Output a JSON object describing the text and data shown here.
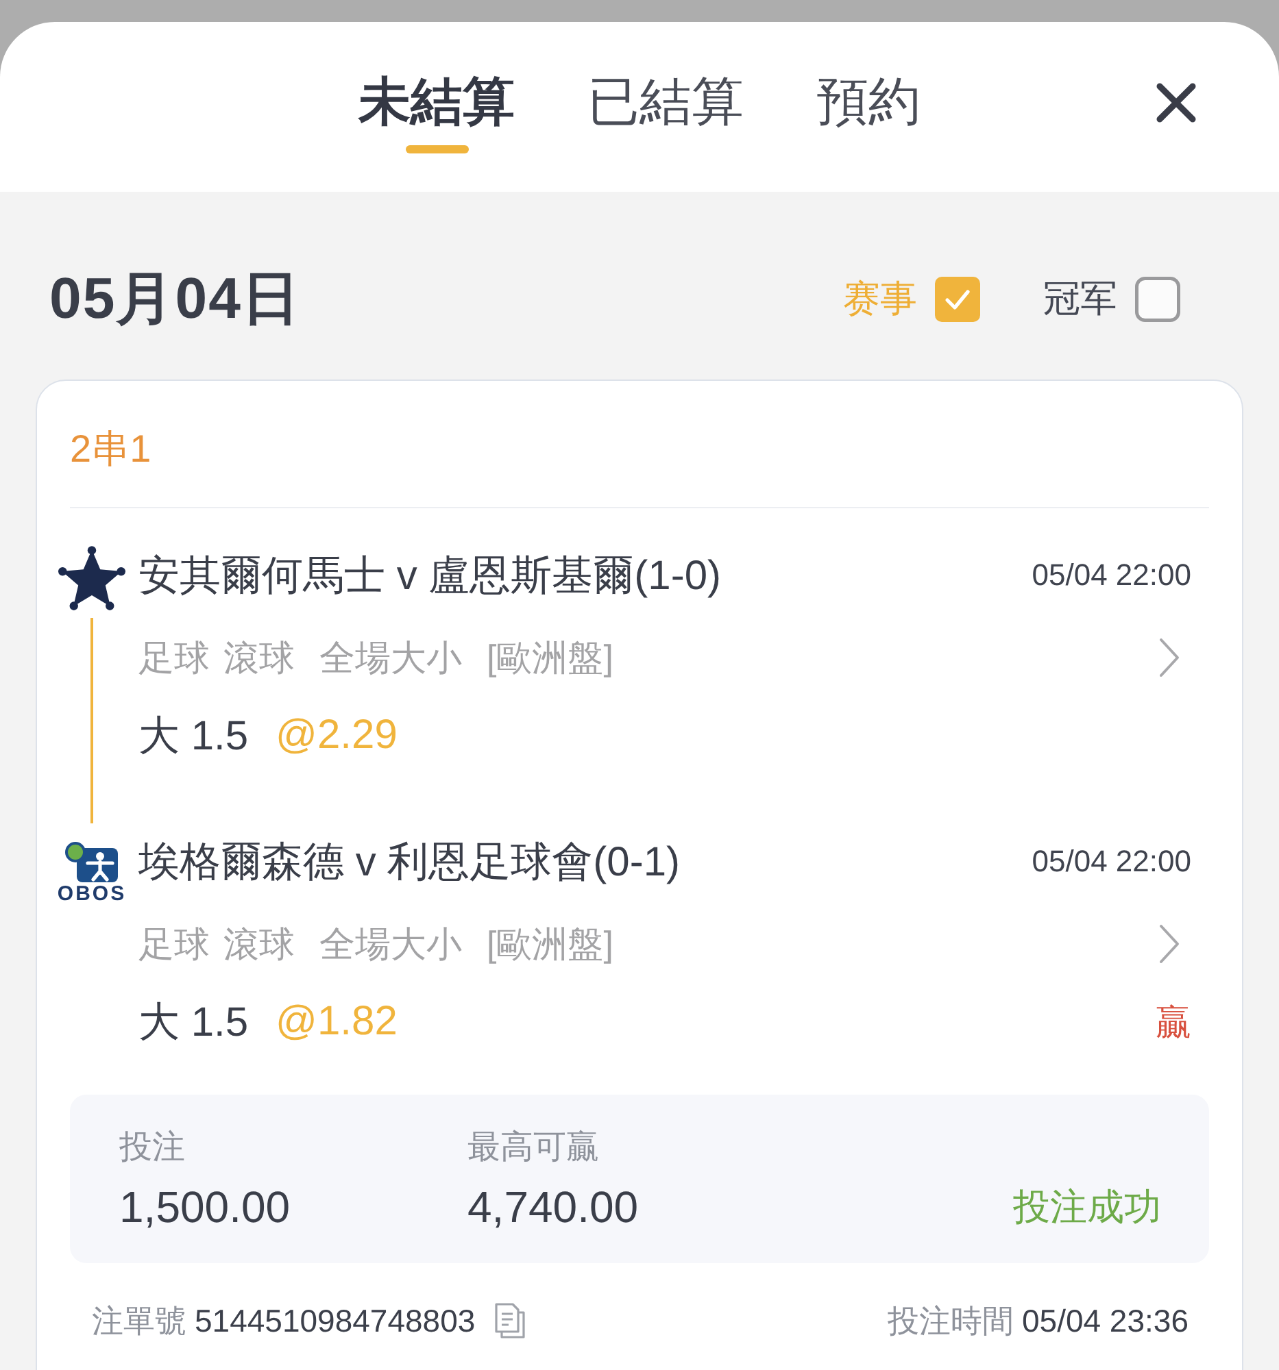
{
  "tabs": [
    {
      "label": "未結算",
      "selected": true
    },
    {
      "label": "已結算",
      "selected": false
    },
    {
      "label": "預約",
      "selected": false
    }
  ],
  "date": "05月04日",
  "filters": [
    {
      "label": "赛事",
      "checked": true
    },
    {
      "label": "冠军",
      "checked": false
    }
  ],
  "bet": {
    "type": "2串1",
    "legs": [
      {
        "logo": {
          "kind": "star"
        },
        "match": "安其爾何馬士 v 盧恩斯基爾(1-0)",
        "time": "05/04 22:00",
        "tags": [
          "足球",
          "滾球",
          "全場大小",
          "[歐洲盤]"
        ],
        "selection": "大 1.5",
        "odds": "@2.29"
      },
      {
        "logo": {
          "kind": "wordmark",
          "text": "OBOS"
        },
        "match": "埃格爾森德 v 利恩足球會(0-1)",
        "time": "05/04 22:00",
        "tags": [
          "足球",
          "滾球",
          "全場大小",
          "[歐洲盤]"
        ],
        "selection": "大 1.5",
        "odds": "@1.82",
        "result": "贏"
      }
    ],
    "summary": {
      "fields": [
        {
          "label": "投注",
          "value": "1,500.00"
        },
        {
          "label": "最高可贏",
          "value": "4,740.00"
        }
      ],
      "status": "投注成功"
    },
    "bet_number": {
      "label": "注單號",
      "value": "5144510984748803"
    },
    "bet_time": {
      "label": "投注時間",
      "value": "05/04 23:36"
    }
  }
}
